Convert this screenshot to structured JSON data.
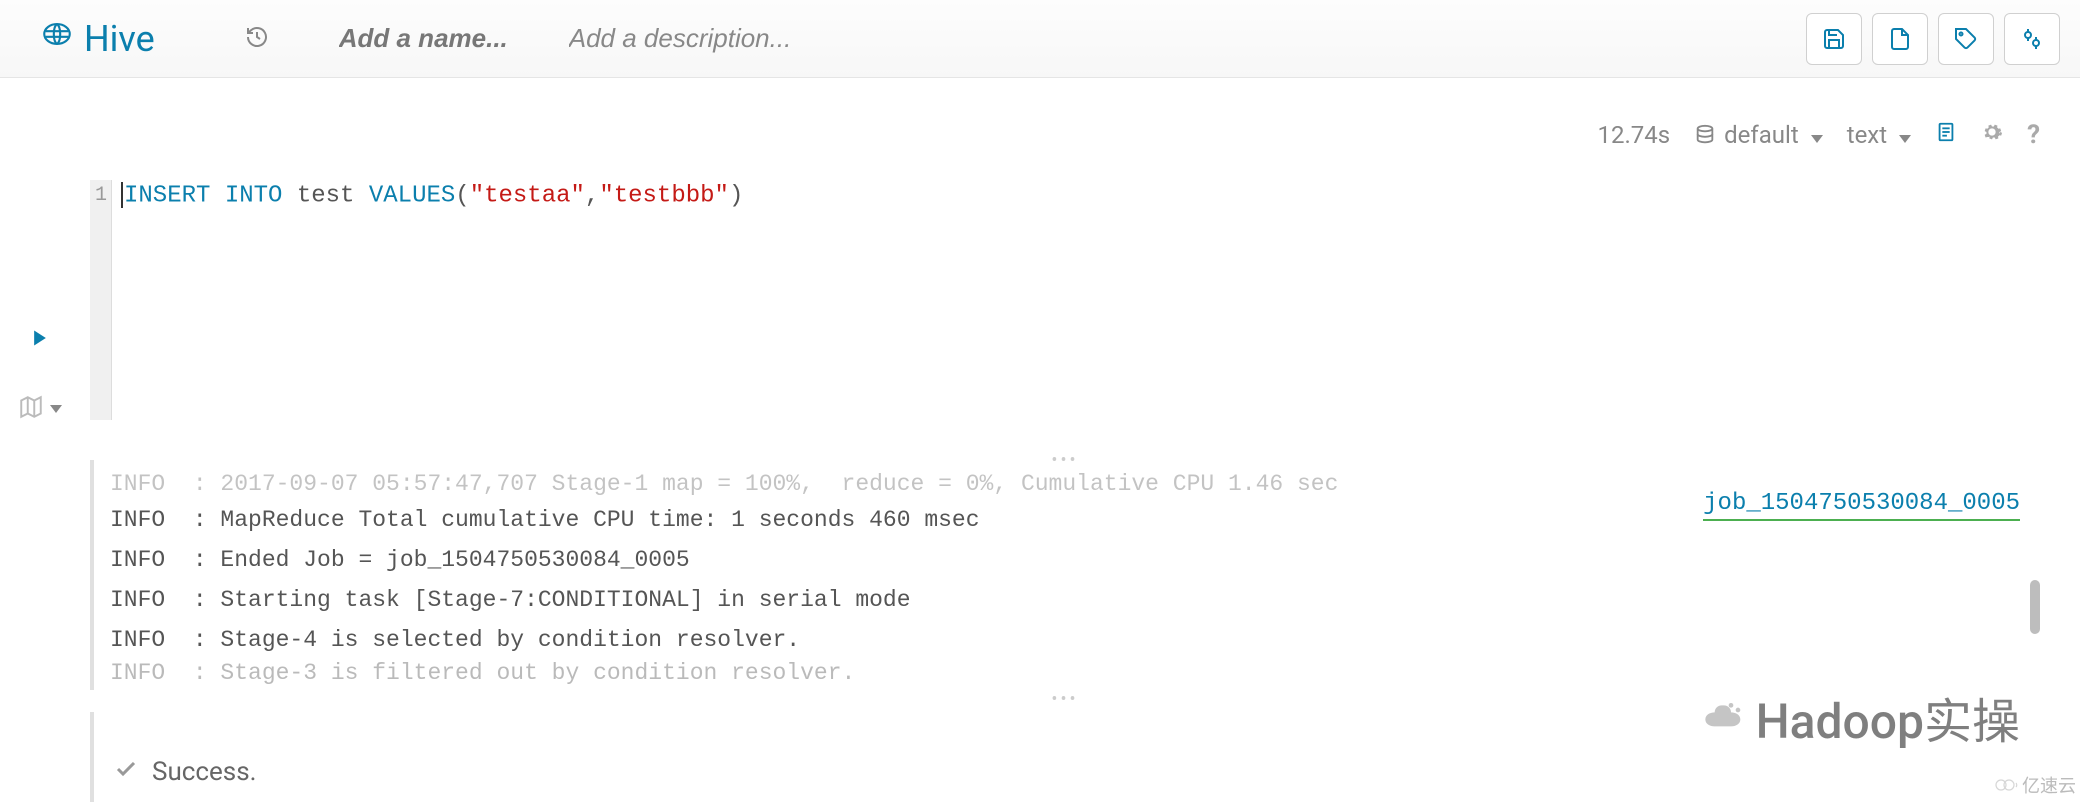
{
  "header": {
    "app_name": "Hive",
    "name_placeholder": "Add a name...",
    "desc_placeholder": "Add a description..."
  },
  "toolbar": {
    "elapsed": "12.74s",
    "database": "default",
    "output_mode": "text"
  },
  "editor": {
    "line_number": "1",
    "sql": {
      "kw1": "INSERT ",
      "kw2": "INTO ",
      "ident": "test ",
      "kw3": "VALUES",
      "paren_open": "(",
      "str1": "\"testaa\"",
      "comma": ",",
      "str2": "\"testbbb\"",
      "paren_close": ")"
    }
  },
  "log": {
    "cut_top": "INFO  : 2017-09-07 05:57:47,707 Stage-1 map = 100%,  reduce = 0%, Cumulative CPU 1.46 sec",
    "lines": [
      "INFO  : MapReduce Total cumulative CPU time: 1 seconds 460 msec",
      "INFO  : Ended Job = job_1504750530084_0005",
      "INFO  : Starting task [Stage-7:CONDITIONAL] in serial mode",
      "INFO  : Stage-4 is selected by condition resolver."
    ],
    "cut_bot": "INFO  : Stage-3 is filtered out by condition resolver.",
    "job_link": "job_1504750530084_0005"
  },
  "result": {
    "status": "Success."
  },
  "watermarks": {
    "main": "Hadoop实操",
    "corner": "亿速云"
  }
}
